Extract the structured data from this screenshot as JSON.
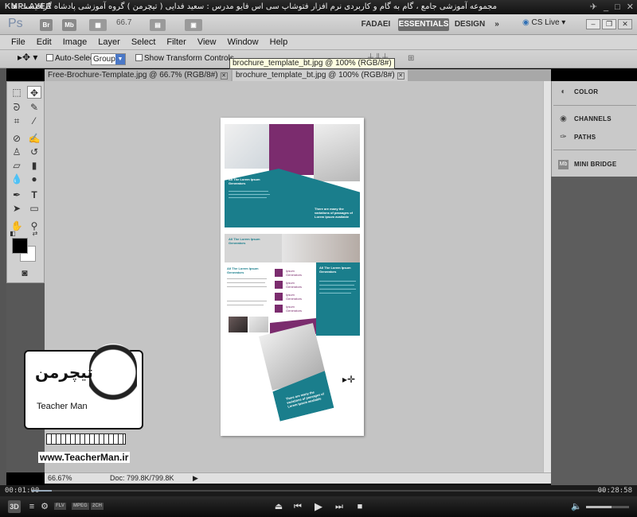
{
  "player": {
    "logo": "KMPLAYER",
    "caption": "مجموعه آموزشی جامع ، گام به گام و کاربردی نرم افزار فتوشاپ سی اس فایو  مدرس : سعید فدایی ( تیچرمن ) گروه آموزشی پادشاه گرافیست ها",
    "time_elapsed": "00:01:00",
    "time_total": "00:28:58",
    "progress": 0.035,
    "volume": 0.6,
    "badges": [
      "3D",
      "FLV",
      "MPEG",
      "2CH"
    ]
  },
  "photoshop": {
    "logo": "Ps",
    "chips": [
      "Br",
      "Mb"
    ],
    "zoom_level": "66.7",
    "workspaces": [
      "FADAEI",
      "ESSENTIALS",
      "DESIGN"
    ],
    "active_workspace": "ESSENTIALS",
    "cs_live": "CS Live",
    "menu": [
      "File",
      "Edit",
      "Image",
      "Layer",
      "Select",
      "Filter",
      "View",
      "Window",
      "Help"
    ],
    "options": {
      "auto_select_label": "Auto-Select:",
      "auto_select_value": "Group",
      "show_transform_label": "Show Transform Controls"
    },
    "tooltip": "brochure_template_bt.jpg @ 100% (RGB/8#)",
    "tabs": [
      {
        "label": "Free-Brochure-Template.jpg @ 66.7% (RGB/8#)",
        "active": false
      },
      {
        "label": "brochure_template_bt.jpg @ 100% (RGB/8#)",
        "active": true
      }
    ],
    "status": {
      "zoom": "66.67%",
      "doc": "Doc: 799.8K/799.8K"
    },
    "panels": [
      {
        "icon": "color-icon",
        "label": "COLOR"
      },
      {
        "icon": "channels-icon",
        "label": "CHANNELS"
      },
      {
        "icon": "paths-icon",
        "label": "PATHS"
      },
      {
        "icon": "mini-bridge-icon",
        "label": "MINI BRIDGE"
      }
    ]
  },
  "brochure": {
    "heading1": "All The Lorem Ipsum Generators",
    "tagline1": "There are many the variations of passages of Lorem Ipsum available",
    "heading2": "All The Lorem Ipsum Generators",
    "heading3": "All The Lorem Ipsum Generators",
    "heading4": "All The Lorem Ipsum Generators",
    "list_item": "Ipsum Generators",
    "tagline2": "There are many the variations of passages of Lorem Ipsum available"
  },
  "watermark": {
    "brand_fa": "تیچرمن",
    "brand_en": "Teacher Man",
    "url": "www.TeacherMan.ir"
  }
}
